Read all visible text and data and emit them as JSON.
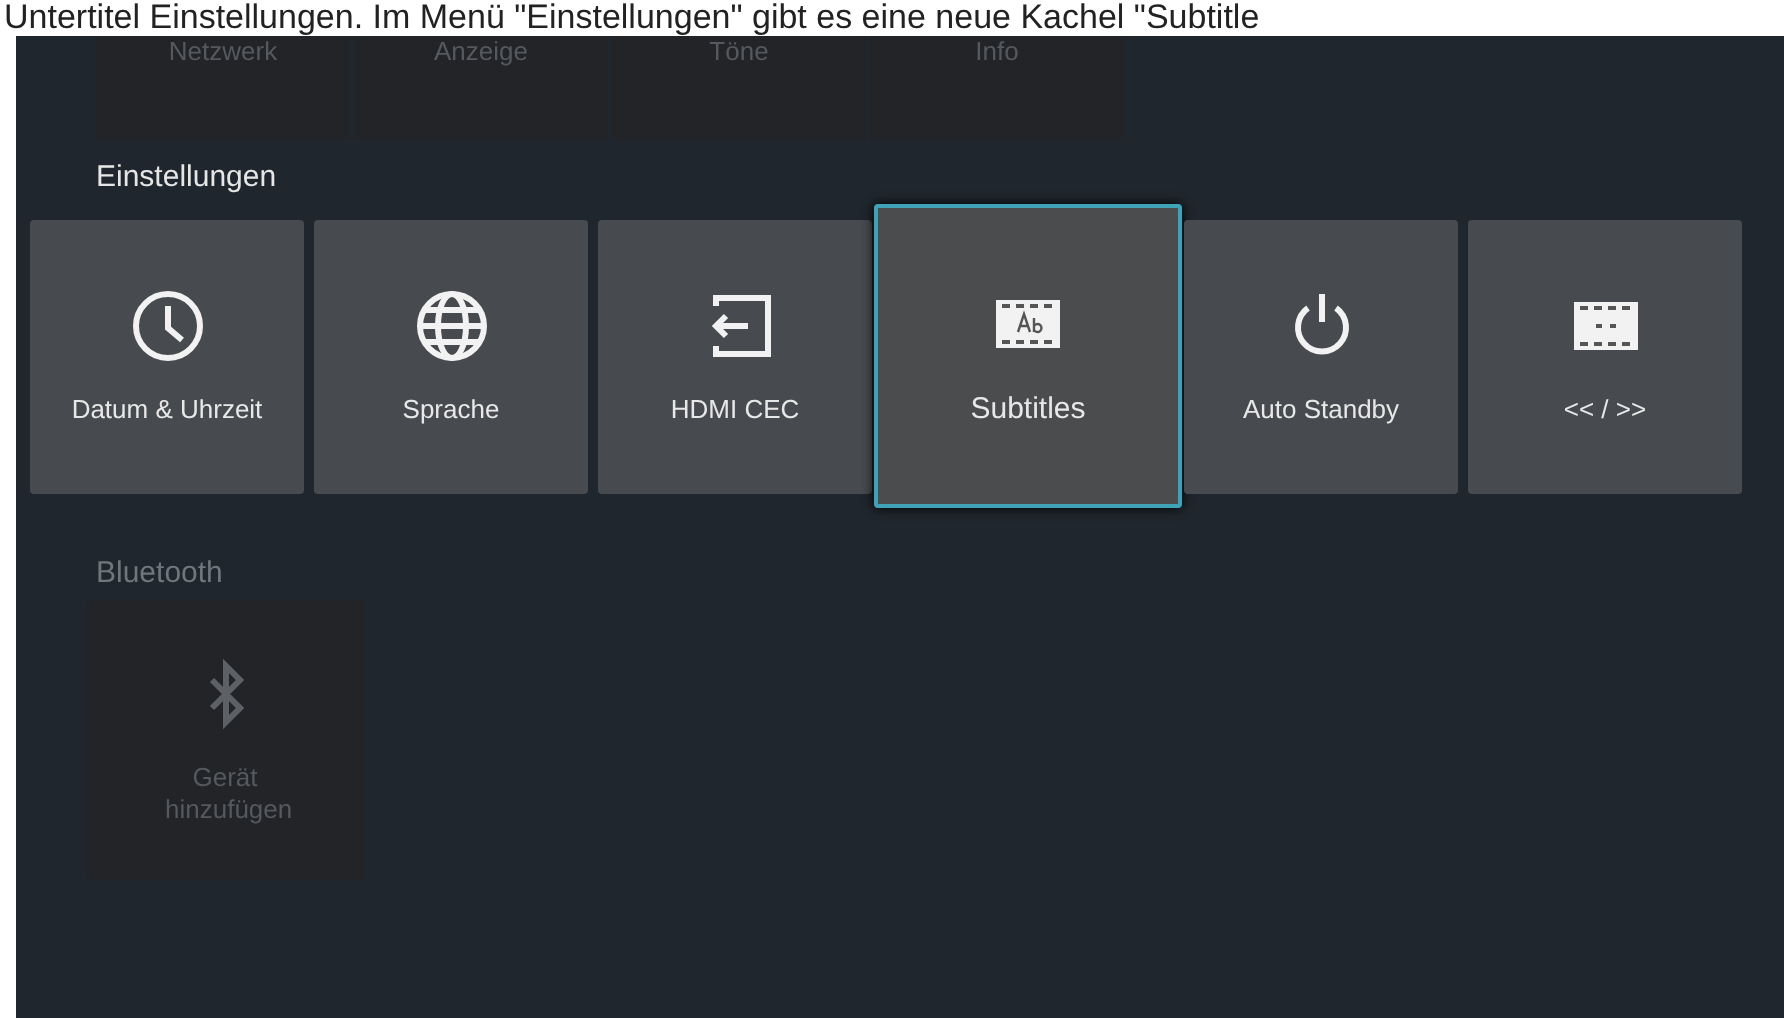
{
  "caption": "Untertitel Einstellungen. Im Menü \"Einstellungen\" gibt es eine neue Kachel \"Subtitle",
  "sections": [
    {
      "dimmed": true,
      "tiles": [
        {
          "label": "Netzwerk",
          "kind": "plain",
          "selected": false
        },
        {
          "label": "Anzeige",
          "kind": "plain",
          "selected": false
        },
        {
          "label": "Töne",
          "kind": "plain",
          "selected": false
        },
        {
          "label": "Info",
          "kind": "plain",
          "selected": false
        }
      ]
    },
    {
      "heading": "Einstellungen",
      "dimmed": false,
      "tiles": [
        {
          "label": "Datum & Uhrzeit",
          "kind": "clock",
          "selected": false
        },
        {
          "label": "Sprache",
          "kind": "globe",
          "selected": false
        },
        {
          "label": "HDMI CEC",
          "kind": "input",
          "selected": false
        },
        {
          "label": "Subtitles",
          "kind": "subtitles",
          "selected": true
        },
        {
          "label": "Auto Standby",
          "kind": "power",
          "selected": false
        },
        {
          "label": "<< / >>",
          "kind": "film",
          "selected": false
        }
      ]
    },
    {
      "heading": "Bluetooth",
      "dimmed": true,
      "tiles": [
        {
          "label": "Gerät hinzufügen",
          "kind": "bluetooth",
          "selected": false
        }
      ]
    }
  ]
}
